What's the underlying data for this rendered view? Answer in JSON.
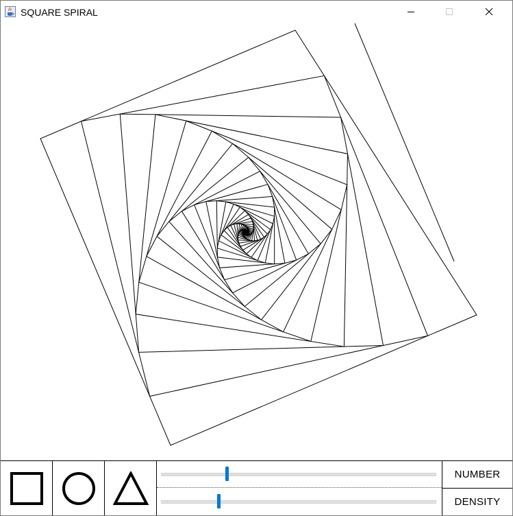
{
  "window": {
    "title": "SQUARE SPIRAL",
    "icon": "java-cup-icon",
    "controls": [
      "minimize-icon",
      "maximize-icon",
      "close-icon"
    ]
  },
  "drawing": {
    "shape": "square spiral",
    "stroke_color": "#000000",
    "background": "#ffffff"
  },
  "toolbar": {
    "shapes": [
      {
        "name": "square",
        "icon": "square-icon"
      },
      {
        "name": "circle",
        "icon": "circle-icon"
      },
      {
        "name": "triangle",
        "icon": "triangle-icon"
      }
    ],
    "number_label": "NUMBER",
    "density_label": "DENSITY",
    "number_value": 0.24,
    "density_value": 0.21,
    "slider_color": "#0078d7"
  }
}
